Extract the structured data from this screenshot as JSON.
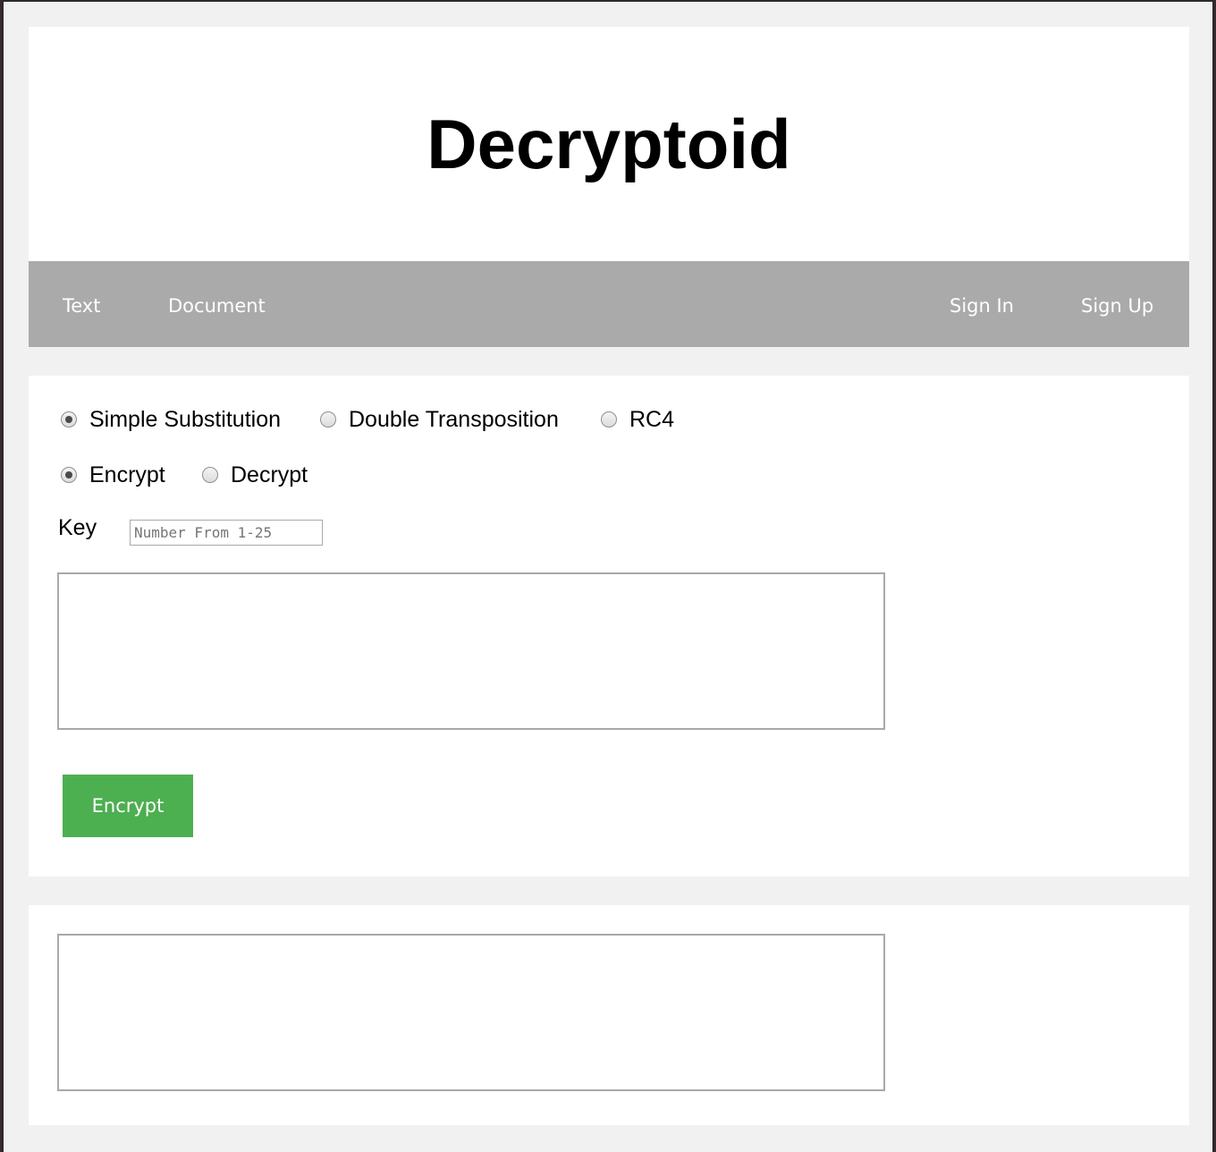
{
  "header": {
    "title": "Decryptoid"
  },
  "nav": {
    "left": [
      {
        "label": "Text"
      },
      {
        "label": "Document"
      }
    ],
    "right": [
      {
        "label": "Sign In"
      },
      {
        "label": "Sign Up"
      }
    ]
  },
  "cipher_options": [
    {
      "label": "Simple Substitution",
      "checked": true
    },
    {
      "label": "Double Transposition",
      "checked": false
    },
    {
      "label": "RC4",
      "checked": false
    }
  ],
  "mode_options": [
    {
      "label": "Encrypt",
      "checked": true
    },
    {
      "label": "Decrypt",
      "checked": false
    }
  ],
  "key": {
    "label": "Key",
    "value": "",
    "placeholder": "Number From 1-25"
  },
  "input_text": {
    "value": ""
  },
  "action": {
    "button_label": "Encrypt"
  },
  "output_text": {
    "value": ""
  },
  "colors": {
    "nav_bg": "#aaaaaa",
    "button_bg": "#4caf50",
    "page_bg": "#f1f1f1"
  }
}
